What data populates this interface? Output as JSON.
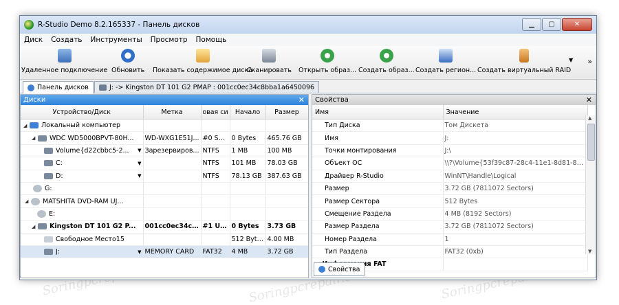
{
  "window": {
    "title": "R-Studio Demo 8.2.165337 - Панель дисков"
  },
  "menu": [
    "Диск",
    "Создать",
    "Инструменты",
    "Просмотр",
    "Помощь"
  ],
  "toolbar": {
    "remote": "Удаленное подключение",
    "refresh": "Обновить",
    "show_contents": "Показать содержимое диска",
    "scan": "Сканировать",
    "open_image": "Открыть образ...",
    "create_image": "Создать образ...",
    "create_region": "Создать регион...",
    "create_raid": "Создать виртуальный RAID",
    "more": "»"
  },
  "tabs": [
    {
      "label": "Панель дисков"
    },
    {
      "label": "J: -> Kingston DT 101 G2 PMAP : 001cc0ec34c8bba1a6450096"
    }
  ],
  "disks_panel": {
    "title": "Диски",
    "columns": [
      "Устройство/Диск",
      "Метка",
      "овая си",
      "Начало",
      "Размер"
    ],
    "rows": [
      {
        "name": "Локальный компьютер",
        "label": "",
        "fs": "",
        "start": "",
        "size": ""
      },
      {
        "name": "WDC WD5000BPVT-80H...",
        "label": "WD-WXG1E51J...",
        "fs": "#0 SA...",
        "start": "0 Bytes",
        "size": "465.76 GB"
      },
      {
        "name": "Volume{d22cbbc5-2...",
        "label": "Зарезервиров...",
        "fs": "NTFS",
        "start": "1 MB",
        "size": "100 MB"
      },
      {
        "name": "C:",
        "label": "",
        "fs": "NTFS",
        "start": "101 MB",
        "size": "78.03 GB"
      },
      {
        "name": "D:",
        "label": "",
        "fs": "NTFS",
        "start": "78.13 GB",
        "size": "387.63 GB"
      },
      {
        "name": "G:",
        "label": "",
        "fs": "",
        "start": "",
        "size": ""
      },
      {
        "name": "MATSHITA DVD-RAM UJ...",
        "label": "",
        "fs": "",
        "start": "",
        "size": ""
      },
      {
        "name": "E:",
        "label": "",
        "fs": "",
        "start": "",
        "size": ""
      },
      {
        "name": "Kingston DT 101 G2 P...",
        "label": "001cc0ec34c...",
        "fs": "#1 USB",
        "start": "0 Bytes",
        "size": "3.73 GB"
      },
      {
        "name": "Свободное Место15",
        "label": "",
        "fs": "",
        "start": "512 Bytes",
        "size": "4.00 MB"
      },
      {
        "name": "J:",
        "label": "MEMORY CARD",
        "fs": "FAT32",
        "start": "4 MB",
        "size": "3.72 GB"
      }
    ]
  },
  "props_panel": {
    "title": "Свойства",
    "columns": [
      "Имя",
      "Значение"
    ],
    "rows": [
      {
        "name": "Тип Диска",
        "value": "Том Дискета"
      },
      {
        "name": "Имя",
        "value": "J:"
      },
      {
        "name": "Точки монтирования",
        "value": "J:\\"
      },
      {
        "name": "Объект ОС",
        "value": "\\\\?\\Volume{53f39c87-28c4-11e1-8d81-82a..."
      },
      {
        "name": "Драйвер R-Studio",
        "value": "WinNT\\Handle\\Logical"
      },
      {
        "name": "Размер",
        "value": "3.72 GB (7811072 Sectors)"
      },
      {
        "name": "Размер Сектора",
        "value": "512 Bytes"
      },
      {
        "name": "Смещение Раздела",
        "value": "4 MB (8192 Sectors)"
      },
      {
        "name": "Размер Раздела",
        "value": "3.72 GB (7811072 Sectors)"
      },
      {
        "name": "Номер Раздела",
        "value": "1"
      },
      {
        "name": "Тип Раздела",
        "value": "FAT32 (0xb)"
      },
      {
        "name": "Информация FAT",
        "value": ""
      }
    ],
    "bottom_tab": "Свойства"
  },
  "colors": {
    "accent": "#2f82d9",
    "selection": "#dbe6f5"
  }
}
